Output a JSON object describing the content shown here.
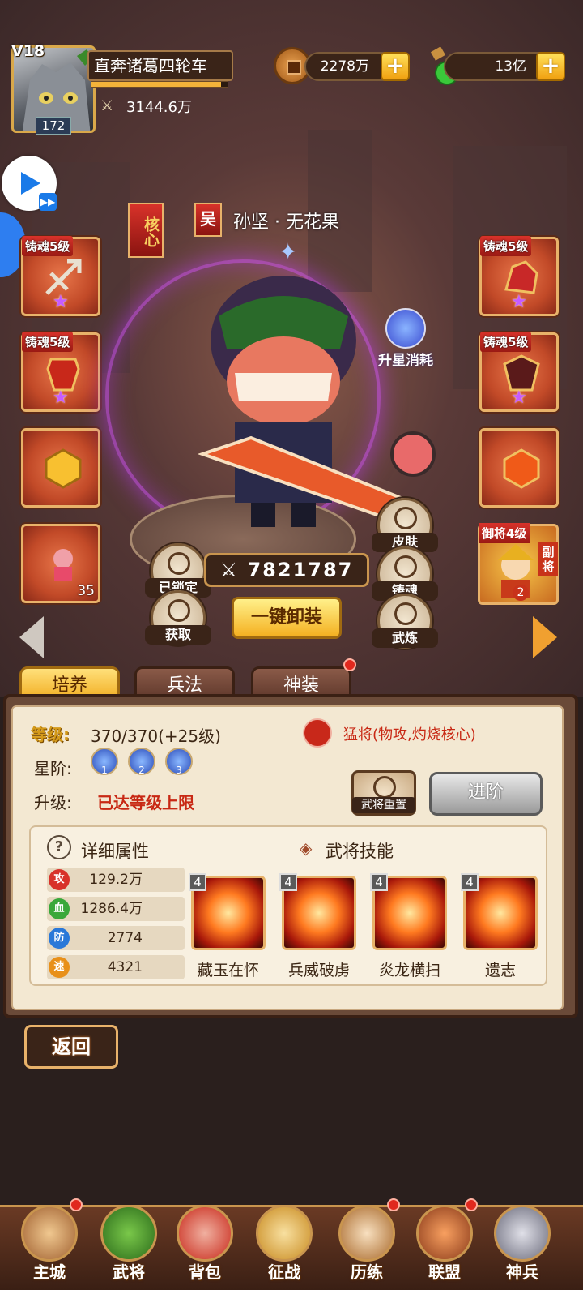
{
  "player": {
    "vip": "V18",
    "name": "直奔诸葛四轮车",
    "level": "172",
    "power": "3144.6万",
    "exp_fraction": 0.95
  },
  "currency": {
    "coins": "2278万",
    "gems": "13亿"
  },
  "hero": {
    "core_tag": "核心",
    "kingdom": "吴",
    "name": "孙坚 · 无花果",
    "power": "7821787",
    "star_up_label": "升星消耗"
  },
  "left_slots": [
    {
      "tag": "铸魂5级",
      "icon": "crossbow-icon",
      "star": true
    },
    {
      "tag": "铸魂5级",
      "icon": "armor-icon",
      "star": true
    },
    {
      "tag": "",
      "icon": "gold-seal-icon",
      "star": false
    },
    {
      "tag": "",
      "icon": "character-icon",
      "star": false,
      "count": "35"
    }
  ],
  "right_slots": [
    {
      "tag": "铸魂5级",
      "icon": "red-horse-icon",
      "star": true
    },
    {
      "tag": "铸魂5级",
      "icon": "dark-armor-icon",
      "star": true
    },
    {
      "tag": "",
      "icon": "fire-seal-icon",
      "star": false
    }
  ],
  "sub_general": {
    "tag": "御将4级",
    "side": "副将",
    "count": "2"
  },
  "buttons": {
    "locked": "已锁定",
    "acquire": "获取",
    "unequip_all": "一键卸装",
    "skin": "皮肤",
    "forge_soul": "铸魂",
    "martial": "武炼",
    "back": "返回",
    "reset": "武将重置",
    "advance": "进阶"
  },
  "tabs": [
    {
      "label": "培养",
      "active": true
    },
    {
      "label": "兵法",
      "active": false
    },
    {
      "label": "神装",
      "active": false,
      "dot": true
    }
  ],
  "cultivate": {
    "level_label": "等级:",
    "level_value": "370/370(+25级)",
    "role_text": "猛将(物攻,灼烧核心)",
    "star_label": "星阶:",
    "stars": [
      "1",
      "2",
      "3"
    ],
    "upgrade_label": "升级:",
    "upgrade_value": "已达等级上限"
  },
  "details": {
    "title": "详细属性",
    "stats": [
      {
        "icon": "攻",
        "value": "129.2万",
        "color": "#d8322a"
      },
      {
        "icon": "血",
        "value": "1286.4万",
        "color": "#3aa83a"
      },
      {
        "icon": "防",
        "value": "2774",
        "color": "#2a78d8"
      },
      {
        "icon": "速",
        "value": "4321",
        "color": "#e8901a"
      }
    ]
  },
  "skills": {
    "title": "武将技能",
    "items": [
      {
        "name": "藏玉在怀",
        "level": "4"
      },
      {
        "name": "兵威破虏",
        "level": "4"
      },
      {
        "name": "炎龙横扫",
        "level": "4"
      },
      {
        "name": "遗志",
        "level": "4"
      }
    ]
  },
  "nav": [
    {
      "label": "主城",
      "dot": true
    },
    {
      "label": "武将",
      "dot": false
    },
    {
      "label": "背包",
      "dot": false
    },
    {
      "label": "征战",
      "dot": false
    },
    {
      "label": "历练",
      "dot": true
    },
    {
      "label": "联盟",
      "dot": true
    },
    {
      "label": "神兵",
      "dot": false
    }
  ]
}
